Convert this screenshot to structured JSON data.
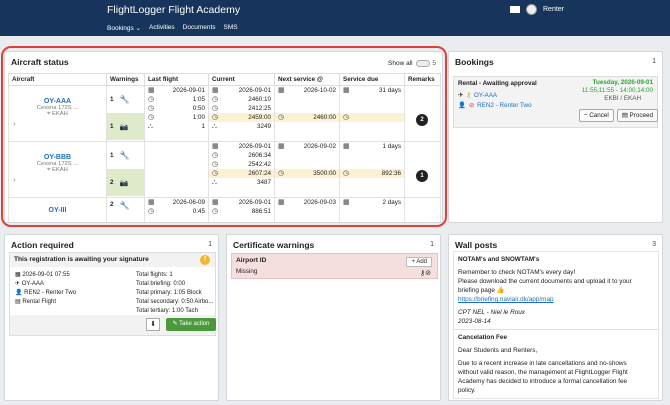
{
  "header": {
    "brand": "FlightLogger Flight Academy",
    "nav": [
      "Bookings ⌄",
      "Activities",
      "Documents",
      "SMS"
    ],
    "user": "Renter"
  },
  "aircraft_panel": {
    "title": "Aircraft status",
    "show_all": "Show all",
    "count": "5",
    "columns": [
      "Aircraft",
      "Warnings",
      "Last flight",
      "Current",
      "Next service @",
      "Service due",
      "Remarks"
    ],
    "rows": [
      {
        "name": "OY-AAA",
        "model": "Cessna 172S ...",
        "location": "EKAH",
        "warnings": [
          {
            "count": "1",
            "icon": "wrench"
          },
          {
            "count": "1",
            "icon": "camera"
          }
        ],
        "last_flight": [
          "2026-09-01",
          "1:05",
          "0:50",
          "1:00",
          "1"
        ],
        "current": [
          "2026-09-01",
          "2460:10",
          "2412:25",
          "2459:00",
          "3249"
        ],
        "next_service": [
          "2026-10-02",
          "",
          "",
          "2460:00",
          ""
        ],
        "service_due": [
          "31 days",
          "",
          "",
          "",
          ""
        ],
        "remarks": "2"
      },
      {
        "name": "OY-BBB",
        "model": "Cessna 172S ...",
        "location": "EKAH",
        "warnings": [
          {
            "count": "1",
            "icon": "wrench"
          },
          {
            "count": "2",
            "icon": "camera"
          }
        ],
        "last_flight": [
          "",
          "",
          "",
          "",
          ""
        ],
        "current": [
          "2026-09-01",
          "2606:34",
          "2542:42",
          "2607:24",
          "3487"
        ],
        "next_service": [
          "2026-09-02",
          "",
          "",
          "3500:00",
          ""
        ],
        "service_due": [
          "1 days",
          "",
          "",
          "892:36",
          ""
        ],
        "remarks": "1"
      },
      {
        "name": "OY-III",
        "model": "",
        "location": "",
        "warnings": [
          {
            "count": "2",
            "icon": "wrench"
          }
        ],
        "last_flight": [
          "2026-06-09",
          "0:45"
        ],
        "current": [
          "2026-09-01",
          "886:51"
        ],
        "next_service": [
          "2026-09-03",
          ""
        ],
        "service_due": [
          "2 days",
          ""
        ],
        "remarks": ""
      }
    ]
  },
  "bookings_panel": {
    "title": "Bookings",
    "count": "1",
    "card": {
      "title": "Rental - Awaiting approval",
      "date": "Tuesday, 2026-09-01",
      "time": "11:55,11:55 - 14:00,14:00",
      "route": "EKBI / EKAH",
      "aircraft": "OY-AAA",
      "renter": "REN2 - Renter Two"
    },
    "cancel": "Cancel",
    "proceed": "Proceed"
  },
  "action_panel": {
    "title": "Action required",
    "count": "1",
    "card_title": "This registration is awaiting your signature",
    "left": [
      "2026-09-01 07:55",
      "OY-AAA",
      "REN2 - Renter Two",
      "Rental Flight"
    ],
    "right": [
      "Total flights: 1",
      "Total briefing: 0:00",
      "Total primary: 1:05 Block",
      "Total secondary: 0:50 Airbo...",
      "Total tertiary: 1:00 Tach"
    ],
    "take_action": "Take action"
  },
  "cert_panel": {
    "title": "Certificate warnings",
    "count": "1",
    "card_title": "Airport ID",
    "add": "+ Add",
    "missing": "Missing"
  },
  "wall_panel": {
    "title": "Wall posts",
    "count": "3",
    "post1": {
      "title": "NOTAM's and SNOWTAM's",
      "l1": "Remember to check NOTAM's every day!",
      "l2": "Please download the current documents and upload it to your",
      "l3": "briefing page 👍",
      "link": "https://briefing.naviair.dk/app/map",
      "sig1": "CPT NEL - Niel le Roux",
      "sig2": "2023-08-14"
    },
    "post2": {
      "title": "Cancelation Fee",
      "l1": "Dear Students and Renters,",
      "l2": "Due to a recent increase in late cancellations and no-shows",
      "l3": "without valid reason, the management at FlightLogger Flight",
      "l4": "Academy has decided to introduce a formal cancellation fee",
      "l5": "policy."
    }
  }
}
